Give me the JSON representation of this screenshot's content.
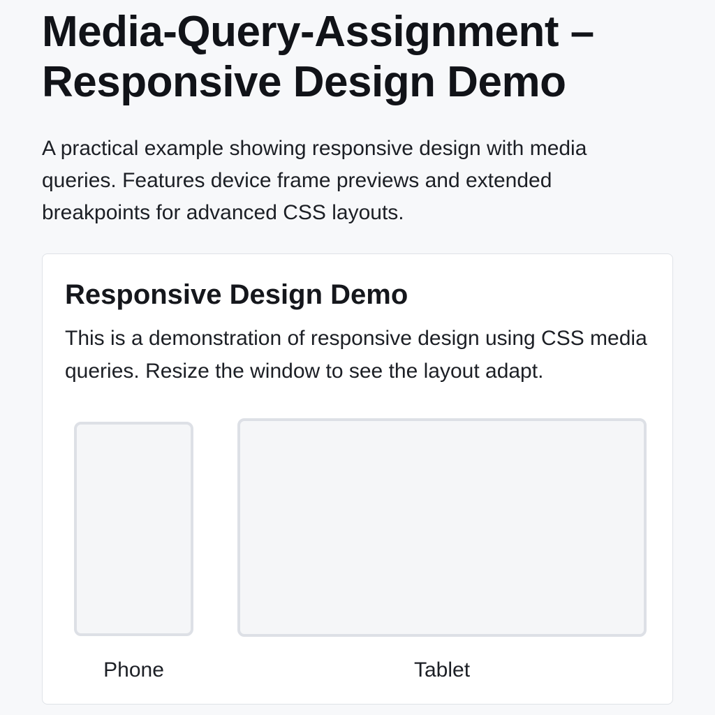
{
  "header": {
    "title": "Media-Query-Assignment –\nResponsive Design Demo",
    "intro": "A practical example showing responsive design with media queries. Features device frame previews and extended breakpoints for advanced CSS layouts."
  },
  "demo": {
    "title": "Responsive Design Demo",
    "description": "This is a demonstration of responsive design using CSS media queries. Resize the window to see the layout adapt.",
    "devices": [
      {
        "label": "Phone"
      },
      {
        "label": "Tablet"
      }
    ]
  }
}
